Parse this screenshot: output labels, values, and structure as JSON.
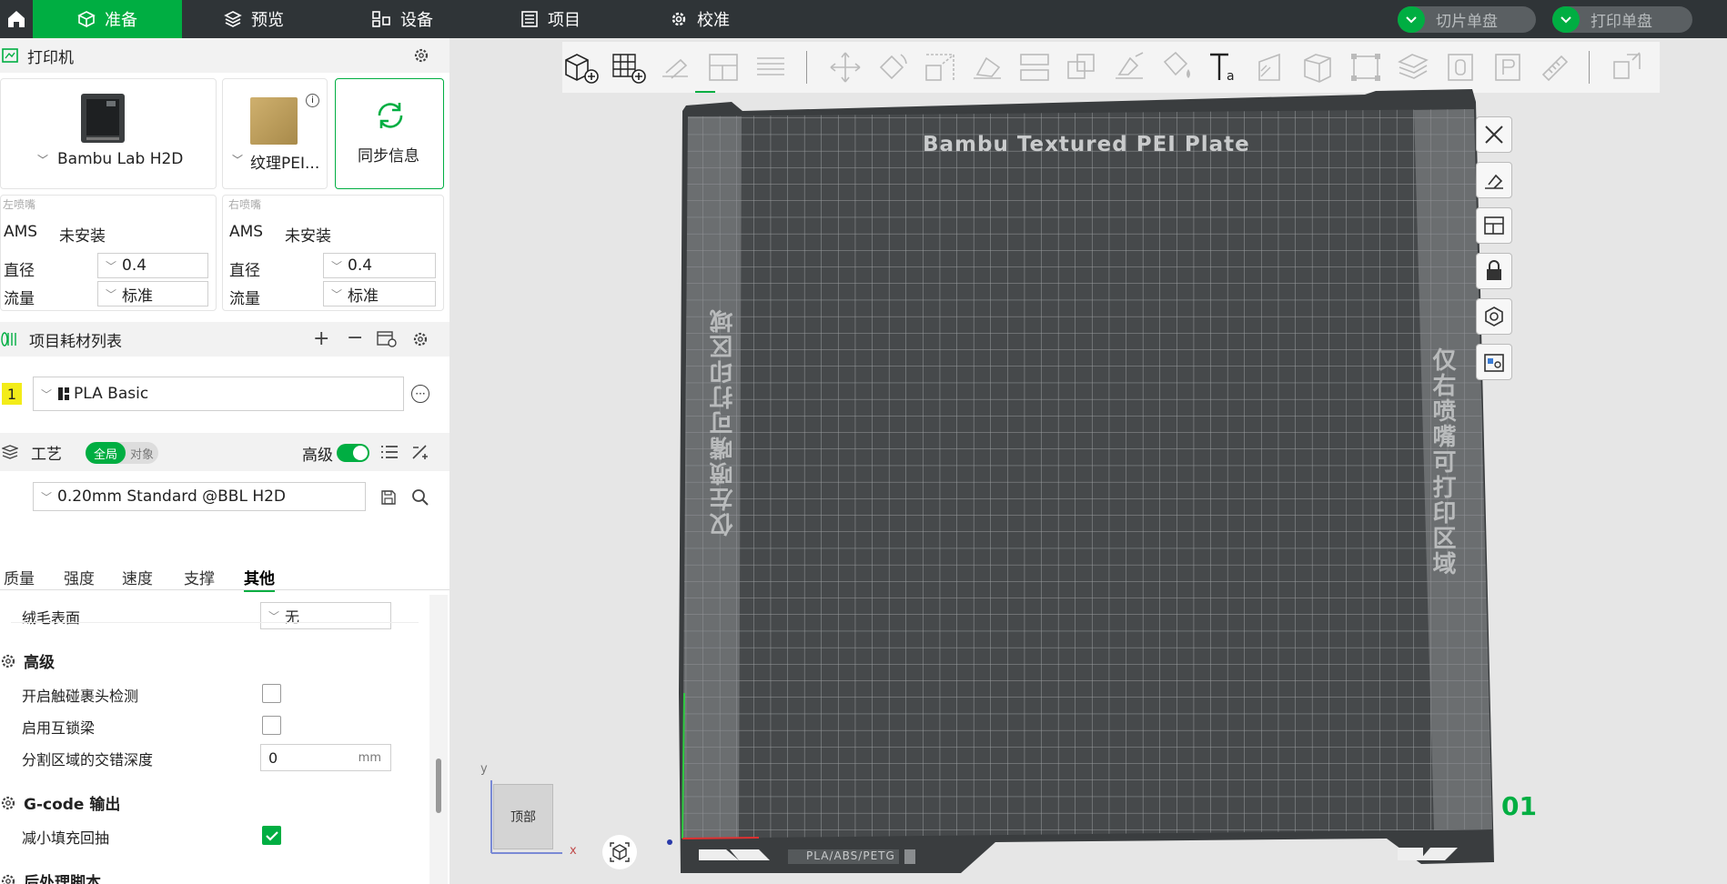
{
  "topbar": {
    "tabs": [
      {
        "label": "准备",
        "icon": "cube-icon",
        "active": true
      },
      {
        "label": "预览",
        "icon": "layers-icon"
      },
      {
        "label": "设备",
        "icon": "device-icon"
      },
      {
        "label": "项目",
        "icon": "list-icon"
      },
      {
        "label": "校准",
        "icon": "gear-icon"
      }
    ],
    "slice_label": "切片单盘",
    "print_label": "打印单盘",
    "accent": "#00ae42"
  },
  "printer": {
    "section_title": "打印机",
    "printer_name": "Bambu Lab H2D",
    "plate_name": "纹理PEI...",
    "sync_label": "同步信息",
    "left": {
      "title": "左喷嘴",
      "ams_label": "AMS",
      "ams_value": "未安装",
      "diameter_label": "直径",
      "diameter_value": "0.4",
      "flow_label": "流量",
      "flow_value": "标准"
    },
    "right": {
      "title": "右喷嘴",
      "ams_label": "AMS",
      "ams_value": "未安装",
      "diameter_label": "直径",
      "diameter_value": "0.4",
      "flow_label": "流量",
      "flow_value": "标准"
    }
  },
  "filament": {
    "section_title": "项目耗材列表",
    "items": [
      {
        "index": "1",
        "name": "PLA Basic",
        "color": "#f3ec19"
      }
    ]
  },
  "process": {
    "section_title": "工艺",
    "toggle_global": "全局",
    "toggle_object": "对象",
    "advanced_label": "高级",
    "preset": "0.20mm Standard @BBL H2D",
    "subtabs": [
      "质量",
      "强度",
      "速度",
      "支撑",
      "其他"
    ],
    "active_subtab": "其他",
    "fuzzy_label": "绒毛表面",
    "fuzzy_value": "无",
    "adv_title": "高级",
    "collision_label": "开启触碰裹头检测",
    "interlock_label": "启用互锁梁",
    "interlock_depth_label": "分割区域的交错深度",
    "interlock_depth_value": "0",
    "interlock_depth_unit": "mm",
    "gcode_title": "G-code 输出",
    "reduce_retract_label": "减小填充回抽",
    "post_title": "后处理脚本"
  },
  "plate": {
    "title": "Bambu Textured PEI Plate",
    "left_zone": "仅左喷嘴可打印区域",
    "right_zone": "仅右喷嘴可打印区域",
    "plate_number": "01",
    "footer_text": "PLA/ABS/PETG"
  },
  "view": {
    "cube_label": "顶部",
    "axis_x": "x",
    "axis_y": "y"
  }
}
